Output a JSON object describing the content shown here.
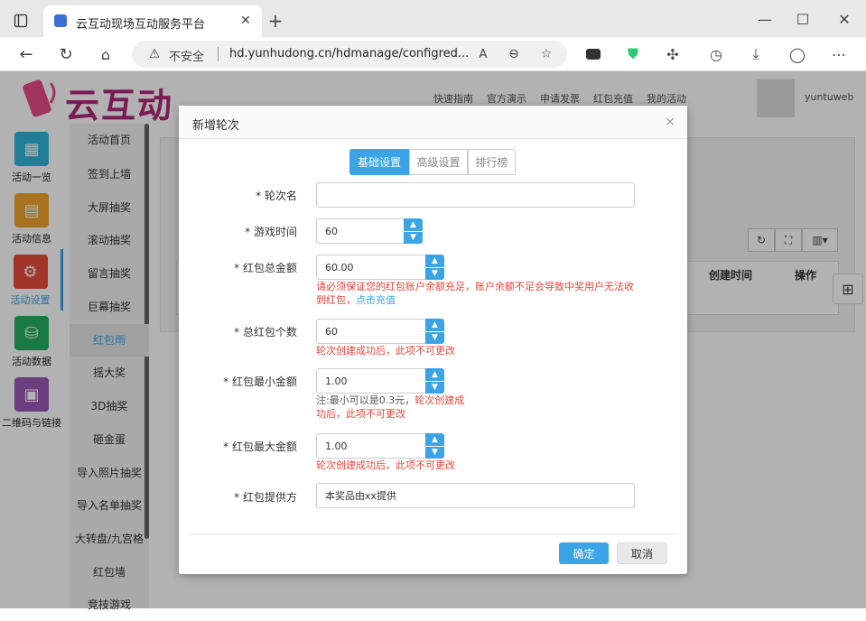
{
  "browser": {
    "tab_title": "云互动现场互动服务平台",
    "insecure_label": "不安全",
    "url": "hd.yunhudong.cn/hdmanage/configred..."
  },
  "header": {
    "logo_text": "云互动",
    "links": [
      "快速指南",
      "官方演示",
      "申请发票",
      "红包充值",
      "我的活动"
    ],
    "username": "yuntuweb"
  },
  "nav": {
    "items": [
      {
        "label": "活动一览",
        "color": "#2eb3d6",
        "icon": "grid-icon"
      },
      {
        "label": "活动信息",
        "color": "#f0a52c",
        "icon": "document-icon"
      },
      {
        "label": "活动设置",
        "color": "#e74c3c",
        "icon": "gear-icon"
      },
      {
        "label": "活动数据",
        "color": "#27ae60",
        "icon": "database-icon"
      },
      {
        "label": "二维码与链接",
        "color": "#9b59b6",
        "icon": "qrcode-icon"
      }
    ]
  },
  "subnav": {
    "items": [
      "活动首页",
      "签到上墙",
      "大屏抽奖",
      "滚动抽奖",
      "留言抽奖",
      "巨幕抽奖",
      "红包雨",
      "摇大奖",
      "3D抽奖",
      "砸金蛋",
      "导入照片抽奖",
      "导入名单抽奖",
      "大转盘/九宫格",
      "红包墙",
      "竞技游戏"
    ]
  },
  "background_table": {
    "headers": [
      "创建时间",
      "操作"
    ]
  },
  "modal": {
    "title": "新增轮次",
    "tabs": [
      "基础设置",
      "高级设置",
      "排行榜"
    ],
    "fields": {
      "round_name": {
        "label": "* 轮次名",
        "value": ""
      },
      "game_time": {
        "label": "* 游戏时间",
        "value": "60"
      },
      "total_amount": {
        "label": "* 红包总金额",
        "value": "60.00",
        "hint": "请必须保证您的红包账户余额充足，账户余额不足会导致中奖用户无法收到红包，",
        "hint_link": "点击充值"
      },
      "total_count": {
        "label": "* 总红包个数",
        "value": "60",
        "hint": "轮次创建成功后，此项不可更改"
      },
      "min_amount": {
        "label": "* 红包最小金额",
        "value": "1.00",
        "hint_gray": "注:最小可以是0.3元，",
        "hint": "轮次创建成功后，此项不可更改"
      },
      "max_amount": {
        "label": "* 红包最大金额",
        "value": "1.00",
        "hint": "轮次创建成功后，此项不可更改"
      },
      "provider": {
        "label": "* 红包提供方",
        "value": "本奖品由xx提供"
      }
    },
    "confirm_label": "确定",
    "cancel_label": "取消"
  }
}
